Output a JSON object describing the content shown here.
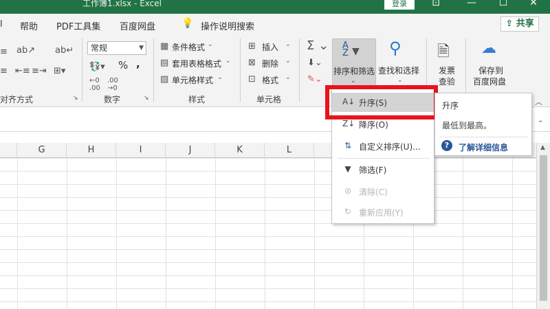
{
  "titlebar": {
    "title": "工作簿1.xlsx  -  Excel",
    "login_label": "登录",
    "controls": [
      "⊡",
      "—",
      "☐",
      "✕"
    ]
  },
  "menubar": {
    "items": [
      "帮助",
      "PDF工具集",
      "百度网盘",
      "操作说明搜索"
    ],
    "share_label": "共享"
  },
  "ribbon": {
    "alignment": {
      "group_label": "对齐方式"
    },
    "number": {
      "format_value": "常规",
      "percent": "%",
      "comma": ",",
      "group_label": "数字"
    },
    "styles": {
      "items": [
        "条件格式",
        "套用表格格式",
        "单元格样式"
      ],
      "group_label": "样式"
    },
    "cells": {
      "items": [
        "插入",
        "删除",
        "格式"
      ],
      "group_label": "单元格"
    },
    "editing": {
      "sort_filter_label": "排序和筛选",
      "find_select_label": "查找和选择",
      "invoice_line1": "发票",
      "invoice_line2": "查验",
      "baidu_line1": "保存到",
      "baidu_line2": "百度网盘"
    }
  },
  "columns": [
    "G",
    "H",
    "I",
    "J",
    "K",
    "L"
  ],
  "dropdown": {
    "items": [
      {
        "label": "升序(S)",
        "icon": "sort-ascending-icon",
        "state": "hover"
      },
      {
        "label": "降序(O)",
        "icon": "sort-descending-icon",
        "state": "normal"
      },
      {
        "label": "自定义排序(U)...",
        "icon": "custom-sort-icon",
        "state": "normal"
      },
      {
        "label": "筛选(F)",
        "icon": "filter-icon",
        "state": "normal"
      },
      {
        "label": "清除(C)",
        "icon": "clear-filter-icon",
        "state": "disabled"
      },
      {
        "label": "重新应用(Y)",
        "icon": "reapply-icon",
        "state": "disabled"
      }
    ]
  },
  "tooltip": {
    "title": "升序",
    "description": "最低到最高。",
    "link": "了解详细信息"
  },
  "colors": {
    "excel_green": "#217346",
    "highlight_red": "#e8131d",
    "link_blue": "#2b579a"
  }
}
